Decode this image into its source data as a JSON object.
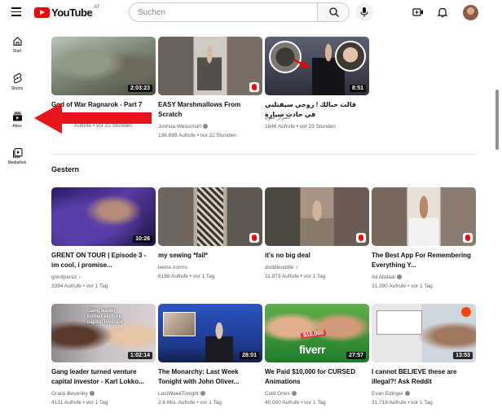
{
  "header": {
    "logo_text": "YouTube",
    "country_code": "AT",
    "search_placeholder": "Suchen"
  },
  "icons": [
    "menu-icon",
    "search-icon",
    "mic-icon",
    "create-icon",
    "bell-icon",
    "home-icon",
    "shorts-icon",
    "subscriptions-icon",
    "library-icon"
  ],
  "sidebar": {
    "items": [
      {
        "label": "Start"
      },
      {
        "label": "Shorts"
      },
      {
        "label": "Abos"
      },
      {
        "label": "Mediathek"
      }
    ]
  },
  "videos_top": [
    {
      "title": "God of War Ragnarok - Part 7",
      "channel": "",
      "stats": "Aufrufe • vor 22 Stunden",
      "duration": "2:03:23"
    },
    {
      "title": "EASY Marshmallows From Scratch",
      "channel": "Joshua Weissman",
      "stats": "136.698 Aufrufe • vor 22 Stunden",
      "duration": ""
    },
    {
      "title": "قالت حبالك ! زوجي سيقتلني في حادث سيارة",
      "channel": "أسرار علوم",
      "stats": "1846 Aufrufe • vor 23 Stunden",
      "duration": "8:51"
    }
  ],
  "section_title": "Gestern",
  "videos_row2": [
    {
      "title": "GRENT ON TOUR | Episode 3 - im cool, i promise...",
      "channel": "grentperez",
      "stats": "3394 Aufrufe • vor 1 Tag",
      "duration": "10:26"
    },
    {
      "title": "my sewing *fail*",
      "channel": "leena norms",
      "stats": "6198 Aufrufe • vor 1 Tag",
      "duration": ""
    },
    {
      "title": "it's no big deal",
      "channel": "doddleoddle",
      "stats": "11.873 Aufrufe • vor 1 Tag",
      "duration": ""
    },
    {
      "title": "The Best App For Remembering Everything Y...",
      "channel": "Ali Abdaal",
      "stats": "31.390 Aufrufe • vor 1 Tag",
      "duration": ""
    }
  ],
  "videos_row3": [
    {
      "title": "Gang leader turned venture capital investor - Karl Lokko...",
      "channel": "Grace Beverley",
      "stats": "4131 Aufrufe • vor 1 Tag",
      "duration": "1:02:14",
      "thumb_text": "Gang leader turned venture capital investor"
    },
    {
      "title": "The Monarchy: Last Week Tonight with John Oliver...",
      "channel": "LastWeekTonight",
      "stats": "2,6 Mio. Aufrufe • vor 1 Tag",
      "duration": "28:01"
    },
    {
      "title": "We Paid $10,000 for CURSED Animations",
      "channel": "Cold Ones",
      "stats": "40.000 Aufrufe • vor 1 Tag",
      "duration": "27:57",
      "thumb_text": "fiverr",
      "thumb_text2": "$10,000"
    },
    {
      "title": "I cannot BELIEVE these are illegal?! Ask Reddit",
      "channel": "Evan Edinger",
      "stats": "31.718 Aufrufe • vor 1 Tag",
      "duration": "13:53"
    }
  ],
  "colors": {
    "brand": "#ff0000",
    "arrow": "#e8141b",
    "text": "#0f0f0f",
    "muted": "#606060"
  }
}
